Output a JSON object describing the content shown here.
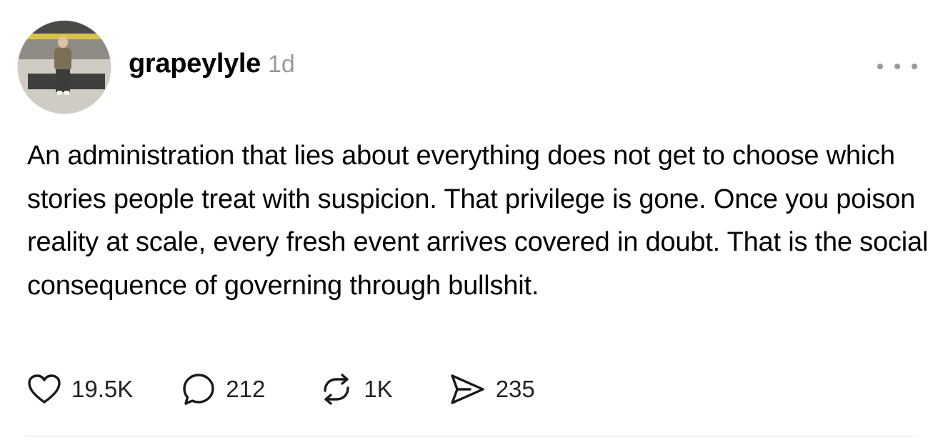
{
  "post": {
    "username": "grapeylyle",
    "timestamp": "1d",
    "avatar_icon": "profile-photo",
    "more_icon": "ellipsis-horizontal-icon",
    "body": "An administration that lies about everything does not get to choose which stories people treat with suspicion. That privilege is gone. Once you poison reality at scale, every fresh event arrives covered in doubt. That is the social consequence of governing through bullshit.",
    "actions": {
      "likes": {
        "icon": "heart-icon",
        "count": "19.5K"
      },
      "replies": {
        "icon": "comment-icon",
        "count": "212"
      },
      "reposts": {
        "icon": "repost-icon",
        "count": "1K"
      },
      "shares": {
        "icon": "send-icon",
        "count": "235"
      }
    }
  },
  "colors": {
    "text": "#000000",
    "secondary": "#9a9a9a",
    "divider": "#e3e3e3",
    "background": "#ffffff"
  }
}
